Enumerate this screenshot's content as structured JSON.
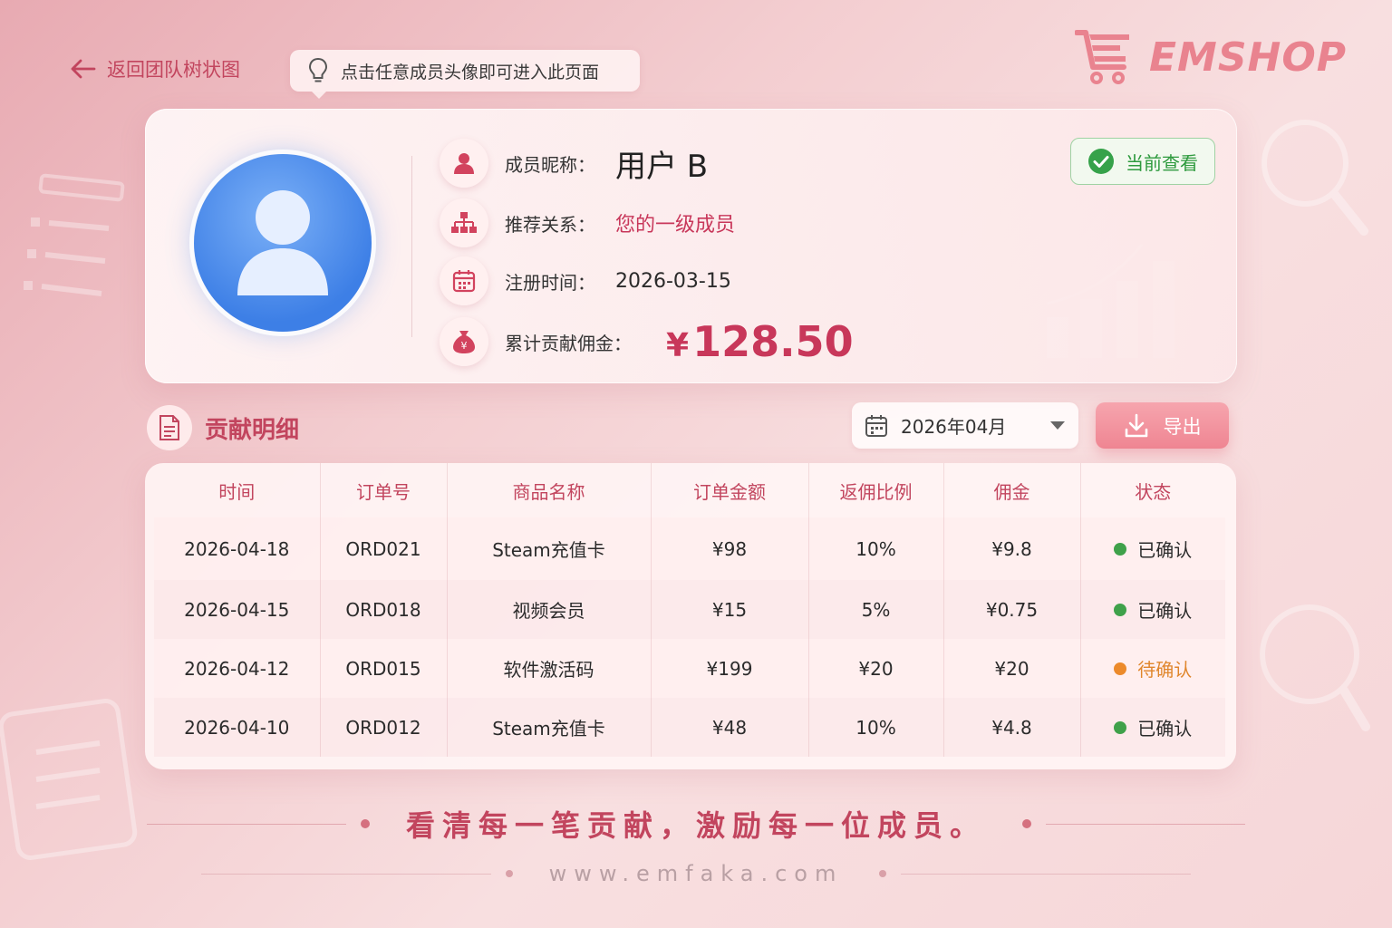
{
  "nav": {
    "back_label": "返回团队树状图",
    "tip": "点击任意成员头像即可进入此页面"
  },
  "brand": {
    "name": "EMSHOP",
    "color": "#e9838f"
  },
  "member": {
    "nickname_label": "成员昵称：",
    "nickname": "用户 B",
    "relation_label": "推荐关系：",
    "relation": "您的一级成员",
    "register_label": "注册时间：",
    "register_date": "2026-03-15",
    "commission_label": "累计贡献佣金：",
    "commission_currency": "¥",
    "commission_amount": "128.50",
    "badge": "当前查看"
  },
  "section": {
    "title": "贡献明细",
    "month": "2026年04月",
    "export_label": "导出"
  },
  "table": {
    "headers": [
      "时间",
      "订单号",
      "商品名称",
      "订单金额",
      "返佣比例",
      "佣金",
      "状态"
    ],
    "rows": [
      [
        "2026-04-18",
        "ORD021",
        "Steam充值卡",
        "¥98",
        "10%",
        "¥9.8",
        "已确认"
      ],
      [
        "2026-04-15",
        "ORD018",
        "视频会员",
        "¥15",
        "5%",
        "¥0.75",
        "已确认"
      ],
      [
        "2026-04-12",
        "ORD015",
        "软件激活码",
        "¥199",
        "¥20",
        "¥20",
        "待确认"
      ],
      [
        "2026-04-10",
        "ORD012",
        "Steam充值卡",
        "¥48",
        "10%",
        "¥4.8",
        "已确认"
      ]
    ],
    "status_colors": {
      "已确认": "#3fa14a",
      "待确认": "#ec8a2b"
    }
  },
  "footer": {
    "slogan": "看清每一笔贡献，激励每一位成员。",
    "url": "www.emfaka.com"
  },
  "colors": {
    "accent": "#c2455e",
    "amount": "#c8375a",
    "avatar": "#3d7fe6"
  }
}
